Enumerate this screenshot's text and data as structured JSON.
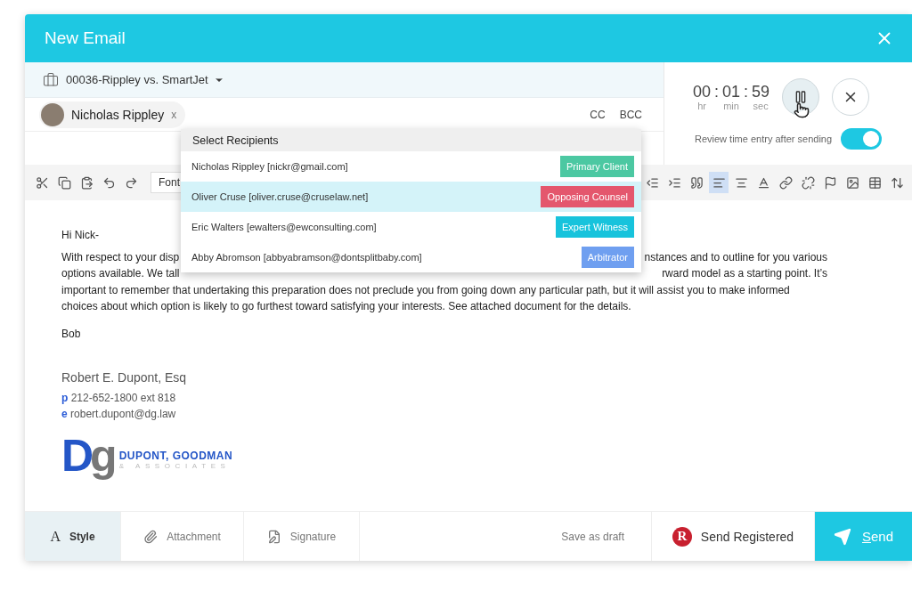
{
  "window": {
    "title": "New Email"
  },
  "matter": {
    "label": "00036-Rippley vs. SmartJet"
  },
  "recipients": [
    {
      "name": "Nicholas Rippley",
      "remove": "x"
    }
  ],
  "copy_links": [
    "CC",
    "BCC"
  ],
  "timer": {
    "parts": [
      {
        "value": "00",
        "unit": "hr"
      },
      {
        "value": "01",
        "unit": "min"
      },
      {
        "value": "59",
        "unit": "sec"
      }
    ],
    "separator": ":"
  },
  "review_toggle": {
    "label": "Review time entry after sending",
    "on": true
  },
  "toolbar": {
    "font": {
      "placeholder": "Font"
    },
    "left": [
      {
        "kind": "cut",
        "selected": false
      },
      {
        "kind": "copy",
        "selected": false
      },
      {
        "kind": "paste",
        "selected": false
      },
      {
        "kind": "undo",
        "selected": false
      },
      {
        "kind": "redo",
        "selected": false
      }
    ],
    "right": [
      {
        "kind": "outdent",
        "selected": false
      },
      {
        "kind": "indent",
        "selected": false
      },
      {
        "kind": "quote",
        "selected": false
      },
      {
        "kind": "align-left",
        "selected": true
      },
      {
        "kind": "align-center",
        "selected": false
      },
      {
        "kind": "text-color",
        "selected": false
      },
      {
        "kind": "link",
        "selected": false
      },
      {
        "kind": "unlink",
        "selected": false
      },
      {
        "kind": "flag",
        "selected": false
      },
      {
        "kind": "image",
        "selected": false
      },
      {
        "kind": "table",
        "selected": false
      },
      {
        "kind": "line-height",
        "selected": false
      }
    ]
  },
  "dropdown": {
    "title": "Select Recipients",
    "items": [
      {
        "contact": "Nicholas Rippley [nickr@gmail.com]",
        "role": "Primary Client",
        "color": "#4cc8a2",
        "selected": false
      },
      {
        "contact": "Oliver Cruse [oliver.cruse@cruselaw.net]",
        "role": "Opposing Counsel",
        "color": "#e4576d",
        "selected": true
      },
      {
        "contact": "Eric Walters [ewalters@ewconsulting.com]",
        "role": "Expert Witness",
        "color": "#17c3dc",
        "selected": false
      },
      {
        "contact": "Abby Abromson [abbyabramson@dontsplitbaby.com]",
        "role": "Arbitrator",
        "color": "#6f9ff0",
        "selected": false
      }
    ]
  },
  "body": {
    "greeting": "Hi Nick-",
    "lines": [
      {
        "left": "With respect to your disp",
        "right": "nstances and to outline for you various"
      },
      {
        "left": "options available. We tall",
        "right": "rward model as a starting point. It’s"
      },
      {
        "left": "important to remember that undertaking this preparation does not preclude you from going down any particular path, but it will assist you to make informed"
      },
      {
        "left": "choices about which option is likely to go furthest toward satisfying your interests.  See attached document for the details."
      }
    ],
    "signoff": "Bob"
  },
  "signature": {
    "name": "Robert E. Dupont, Esq",
    "lines": [
      {
        "tag": "p",
        "text": "212-652-1800 ext 818"
      },
      {
        "tag": "e",
        "text": "robert.dupont@dg.law"
      }
    ],
    "logo": {
      "mark_left": "D",
      "mark_right": "g",
      "firm": "DUPONT, GOODMAN",
      "sub": "& ASSOCIATES"
    }
  },
  "footer": {
    "tabs": [
      {
        "kind": "style",
        "glyph": "A",
        "label": "Style",
        "selected": true
      },
      {
        "kind": "attachment",
        "label": "Attachment",
        "selected": false
      },
      {
        "kind": "signature",
        "label": "Signature",
        "selected": false
      }
    ],
    "draft": "Save as draft",
    "registered": {
      "logo": "R",
      "label": "Send Registered"
    },
    "send": "Send"
  }
}
